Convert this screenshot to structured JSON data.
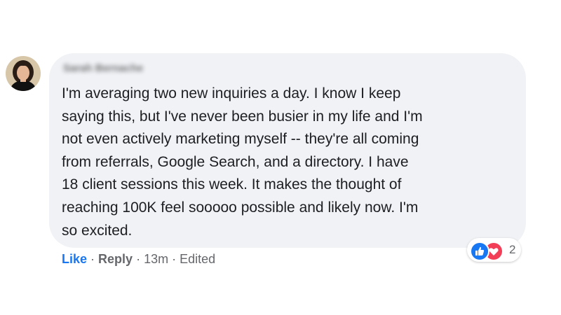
{
  "comment": {
    "author": "Sarah Bernache",
    "text": "I'm averaging two new inquiries a day. I know I keep\nsaying this, but I've never been busier in my life and I'm\nnot even actively marketing myself -- they're all coming\nfrom referrals, Google Search, and a directory. I have\n18 client sessions this week. It makes the thought of\nreaching 100K feel sooooo possible and likely now. I'm\nso excited."
  },
  "actions": {
    "like_label": "Like",
    "reply_label": "Reply",
    "separator": "·",
    "timestamp": "13m",
    "edited_label": "Edited"
  },
  "reactions": {
    "icons": [
      "like-icon",
      "love-icon"
    ],
    "count": "2"
  },
  "colors": {
    "bubble": "#f0f2f5",
    "like_link": "#1877f2",
    "secondary_text": "#65676b",
    "like_reaction": "#1877f2",
    "love_reaction": "#f33e58"
  }
}
